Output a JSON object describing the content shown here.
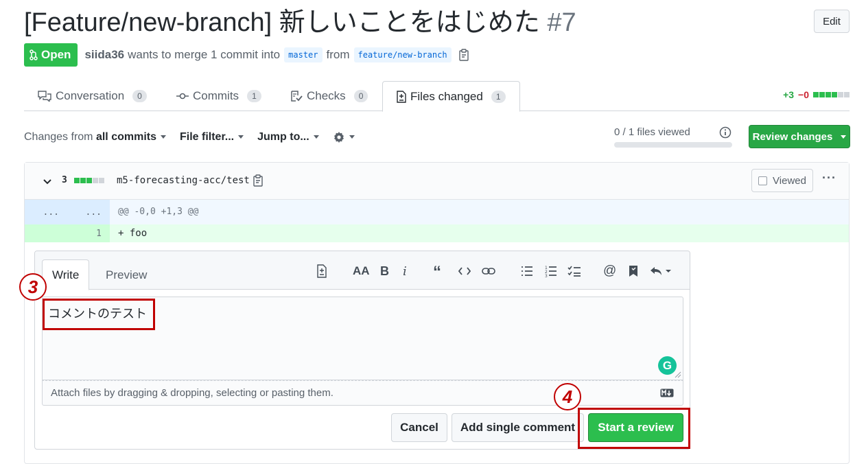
{
  "pr": {
    "title": "[Feature/new-branch] 新しいことをはじめた",
    "number": "#7",
    "edit_label": "Edit",
    "state_label": "Open",
    "author": "siida36",
    "merge_text": "wants to merge 1 commit into",
    "base_branch": "master",
    "from_text": "from",
    "head_branch": "feature/new-branch"
  },
  "tabs": [
    {
      "label": "Conversation",
      "count": "0",
      "icon": "comment-discussion-icon"
    },
    {
      "label": "Commits",
      "count": "1",
      "icon": "git-commit-icon"
    },
    {
      "label": "Checks",
      "count": "0",
      "icon": "checklist-icon"
    },
    {
      "label": "Files changed",
      "count": "1",
      "icon": "file-diff-icon"
    }
  ],
  "diffstat": {
    "additions": "+3",
    "deletions": "−0"
  },
  "toolbar": {
    "changes_from_prefix": "Changes from",
    "changes_from_value": "all commits",
    "file_filter": "File filter...",
    "jump_to": "Jump to...",
    "files_viewed": "0 / 1 files viewed",
    "files_viewed_fraction": 0,
    "review_changes": "Review changes"
  },
  "file": {
    "changes_count": "3",
    "path": "m5-forecasting-acc/test",
    "viewed_label": "Viewed",
    "more": "···",
    "hunk_left": "...",
    "hunk_right": "...",
    "hunk_header": "@@ -0,0 +1,3 @@",
    "line_number": "1",
    "line_text": "+ foo"
  },
  "comment_form": {
    "write_tab": "Write",
    "preview_tab": "Preview",
    "text": "コメントのテスト",
    "attach_text": "Attach files by dragging & dropping, selecting or pasting them.",
    "grammarly": "G",
    "cancel": "Cancel",
    "add_single": "Add single comment",
    "start_review": "Start a review"
  },
  "annotations": {
    "step3": "3",
    "step4": "4",
    "color": "#c00000"
  },
  "colors": {
    "green": "#2cbe4e",
    "link": "#0366d6",
    "add_bg": "#e6ffed",
    "hunk_bg": "#f1f8ff"
  }
}
